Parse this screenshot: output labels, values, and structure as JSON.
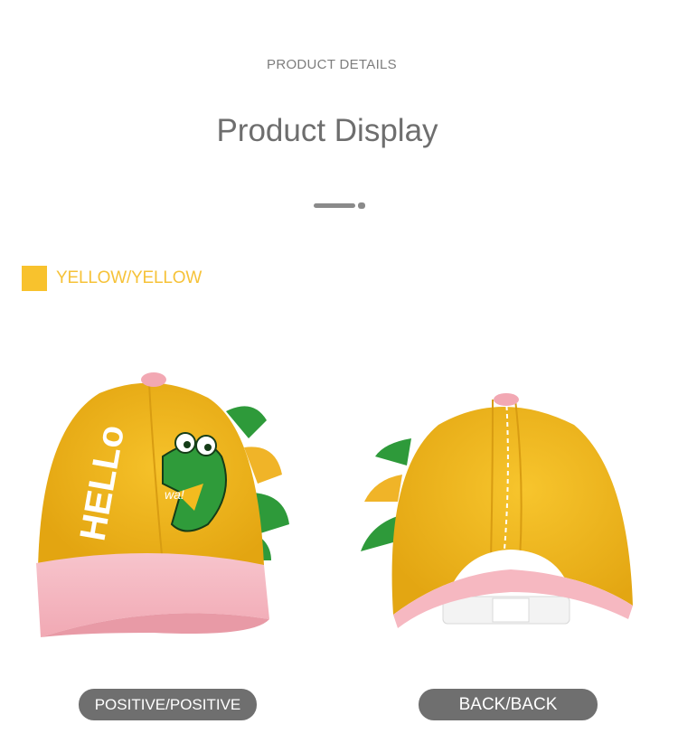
{
  "header": {
    "eyebrow": "PRODUCT DETAILS",
    "title": "Product Display"
  },
  "variant": {
    "name": "YELLOW/YELLOW",
    "swatch_color": "#f8c22d"
  },
  "views": {
    "front_label": "POSITIVE/POSITIVE",
    "back_label": "BACK/BACK"
  },
  "cap_print": {
    "hello_text": "HELLo",
    "dino_text": "wa!"
  },
  "colors": {
    "cap_yellow": "#f3bb1f",
    "brim_pink": "#f6b8c1",
    "dino_green": "#2f9b3a",
    "pill_gray": "#6f6f6f"
  }
}
